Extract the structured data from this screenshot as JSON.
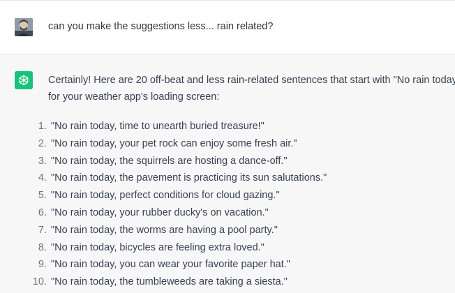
{
  "user_message": {
    "text": "can you make the suggestions less... rain related?"
  },
  "assistant_message": {
    "intro_line1": "Certainly! Here are 20 off-beat and less rain-related sentences that start with \"No rain today,\"",
    "intro_line2": "for your weather app's loading screen:",
    "items": [
      {
        "num": "1.",
        "text": "\"No rain today, time to unearth buried treasure!\""
      },
      {
        "num": "2.",
        "text": "\"No rain today, your pet rock can enjoy some fresh air.\""
      },
      {
        "num": "3.",
        "text": "\"No rain today, the squirrels are hosting a dance-off.\""
      },
      {
        "num": "4.",
        "text": "\"No rain today, the pavement is practicing its sun salutations.\""
      },
      {
        "num": "5.",
        "text": "\"No rain today, perfect conditions for cloud gazing.\""
      },
      {
        "num": "6.",
        "text": "\"No rain today, your rubber ducky's on vacation.\""
      },
      {
        "num": "7.",
        "text": "\"No rain today, the worms are having a pool party.\""
      },
      {
        "num": "8.",
        "text": "\"No rain today, bicycles are feeling extra loved.\""
      },
      {
        "num": "9.",
        "text": "\"No rain today, you can wear your favorite paper hat.\""
      },
      {
        "num": "10.",
        "text": "\"No rain today, the tumbleweeds are taking a siesta.\""
      }
    ]
  },
  "icons": {
    "user_avatar": "user-avatar-icon",
    "assistant_logo": "openai-logo-icon"
  },
  "colors": {
    "assistant_icon_bg": "#19c37d",
    "assistant_row_bg": "#f7f7f8",
    "text": "#374151"
  }
}
